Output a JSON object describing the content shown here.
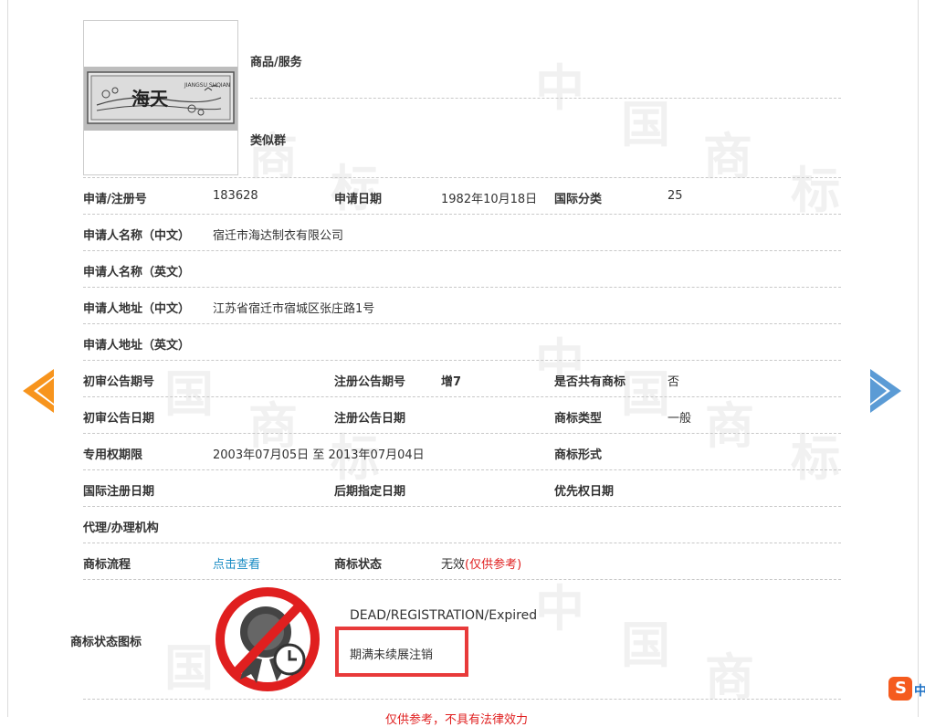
{
  "header_fields": {
    "goods_label": "商品/服务",
    "similar_label": "类似群"
  },
  "trademark_image": {
    "icon": "trademark-logo-image",
    "logo_caption": "JIANGSU SUQIAN",
    "logo_chars": "海天"
  },
  "rows": {
    "reg_no_label": "申请/注册号",
    "reg_no": "183628",
    "app_date_label": "申请日期",
    "app_date": "1982年10月18日",
    "intl_class_label": "国际分类",
    "intl_class": "25",
    "applicant_cn_label": "申请人名称（中文）",
    "applicant_cn": "宿迁市海达制衣有限公司",
    "applicant_en_label": "申请人名称（英文）",
    "address_cn_label": "申请人地址（中文）",
    "address_cn": "江苏省宿迁市宿城区张庄路1号",
    "address_en_label": "申请人地址（英文）",
    "prelim_issue_label": "初审公告期号",
    "reg_issue_label": "注册公告期号",
    "reg_issue": "增7",
    "shared_label": "是否共有商标",
    "shared": "否",
    "prelim_date_label": "初审公告日期",
    "reg_date_label": "注册公告日期",
    "tm_type_label": "商标类型",
    "tm_type": "一般",
    "exclusive_label": "专用权期限",
    "exclusive_start": "2003年07月05日",
    "exclusive_sep": "至",
    "exclusive_end": "2013年07月04日",
    "tm_form_label": "商标形式",
    "intl_reg_date_label": "国际注册日期",
    "later_designation_label": "后期指定日期",
    "priority_date_label": "优先权日期",
    "agent_label": "代理/办理机构",
    "process_label": "商标流程",
    "process_link": "点击查看",
    "status_label": "商标状态",
    "status_value": "无效",
    "status_note": "(仅供参考)",
    "status_icon_label": "商标状态图标"
  },
  "status_icon": {
    "icon": "expired-registration-icon",
    "status_en": "DEAD/REGISTRATION/Expired",
    "status_cn": "期满未续展注销"
  },
  "footer": {
    "disclaimer": "仅供参考，不具有法律效力"
  },
  "watermark": {
    "chars": [
      "中",
      "国",
      "商",
      "标"
    ]
  },
  "nav": {
    "prev_icon": "arrow-left-icon",
    "next_icon": "arrow-right-icon"
  },
  "colors": {
    "link": "#1a8cc4",
    "status_red": "#e01f1f",
    "highlight_box": "#e83a3a",
    "prev_arrow": "#f7941d",
    "next_arrow": "#5b9bd5",
    "sogou": "#f55b1e"
  },
  "ime": {
    "icon": "sogou-ime-icon",
    "letter": "S",
    "text": "中"
  }
}
